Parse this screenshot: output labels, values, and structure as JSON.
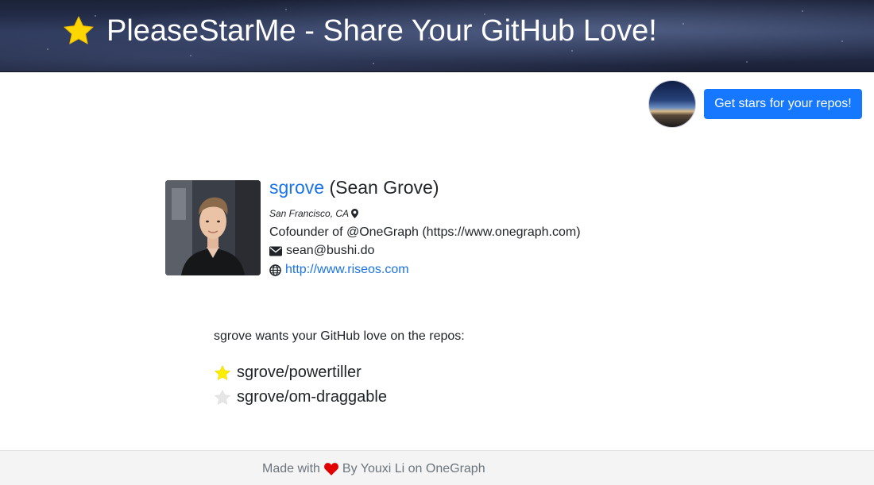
{
  "header": {
    "title": "PleaseStarMe - Share Your GitHub Love!",
    "icon": "star-icon",
    "star_color": "#ffd700"
  },
  "topbar": {
    "cta_label": "Get stars for your repos!",
    "cta_color": "#1677ff",
    "avatar": "user-avatar"
  },
  "profile": {
    "login": "sgrove",
    "full_name": "(Sean Grove)",
    "location": "San Francisco, CA",
    "bio": "Cofounder of @OneGraph (https://www.onegraph.com)",
    "email": "sean@bushi.do",
    "website": "http://www.riseos.com",
    "link_color": "#1a73e8"
  },
  "repos": {
    "intro": "sgrove wants your GitHub love on the repos:",
    "items": [
      {
        "name": "sgrove/powertiller",
        "starred": true,
        "star_color": "#ffee00"
      },
      {
        "name": "sgrove/om-draggable",
        "starred": false,
        "star_color": "#e6e6e6"
      }
    ]
  },
  "footer": {
    "made_with": "Made with",
    "by": "By Youxi Li on OneGraph",
    "heart_color": "#e00000"
  }
}
